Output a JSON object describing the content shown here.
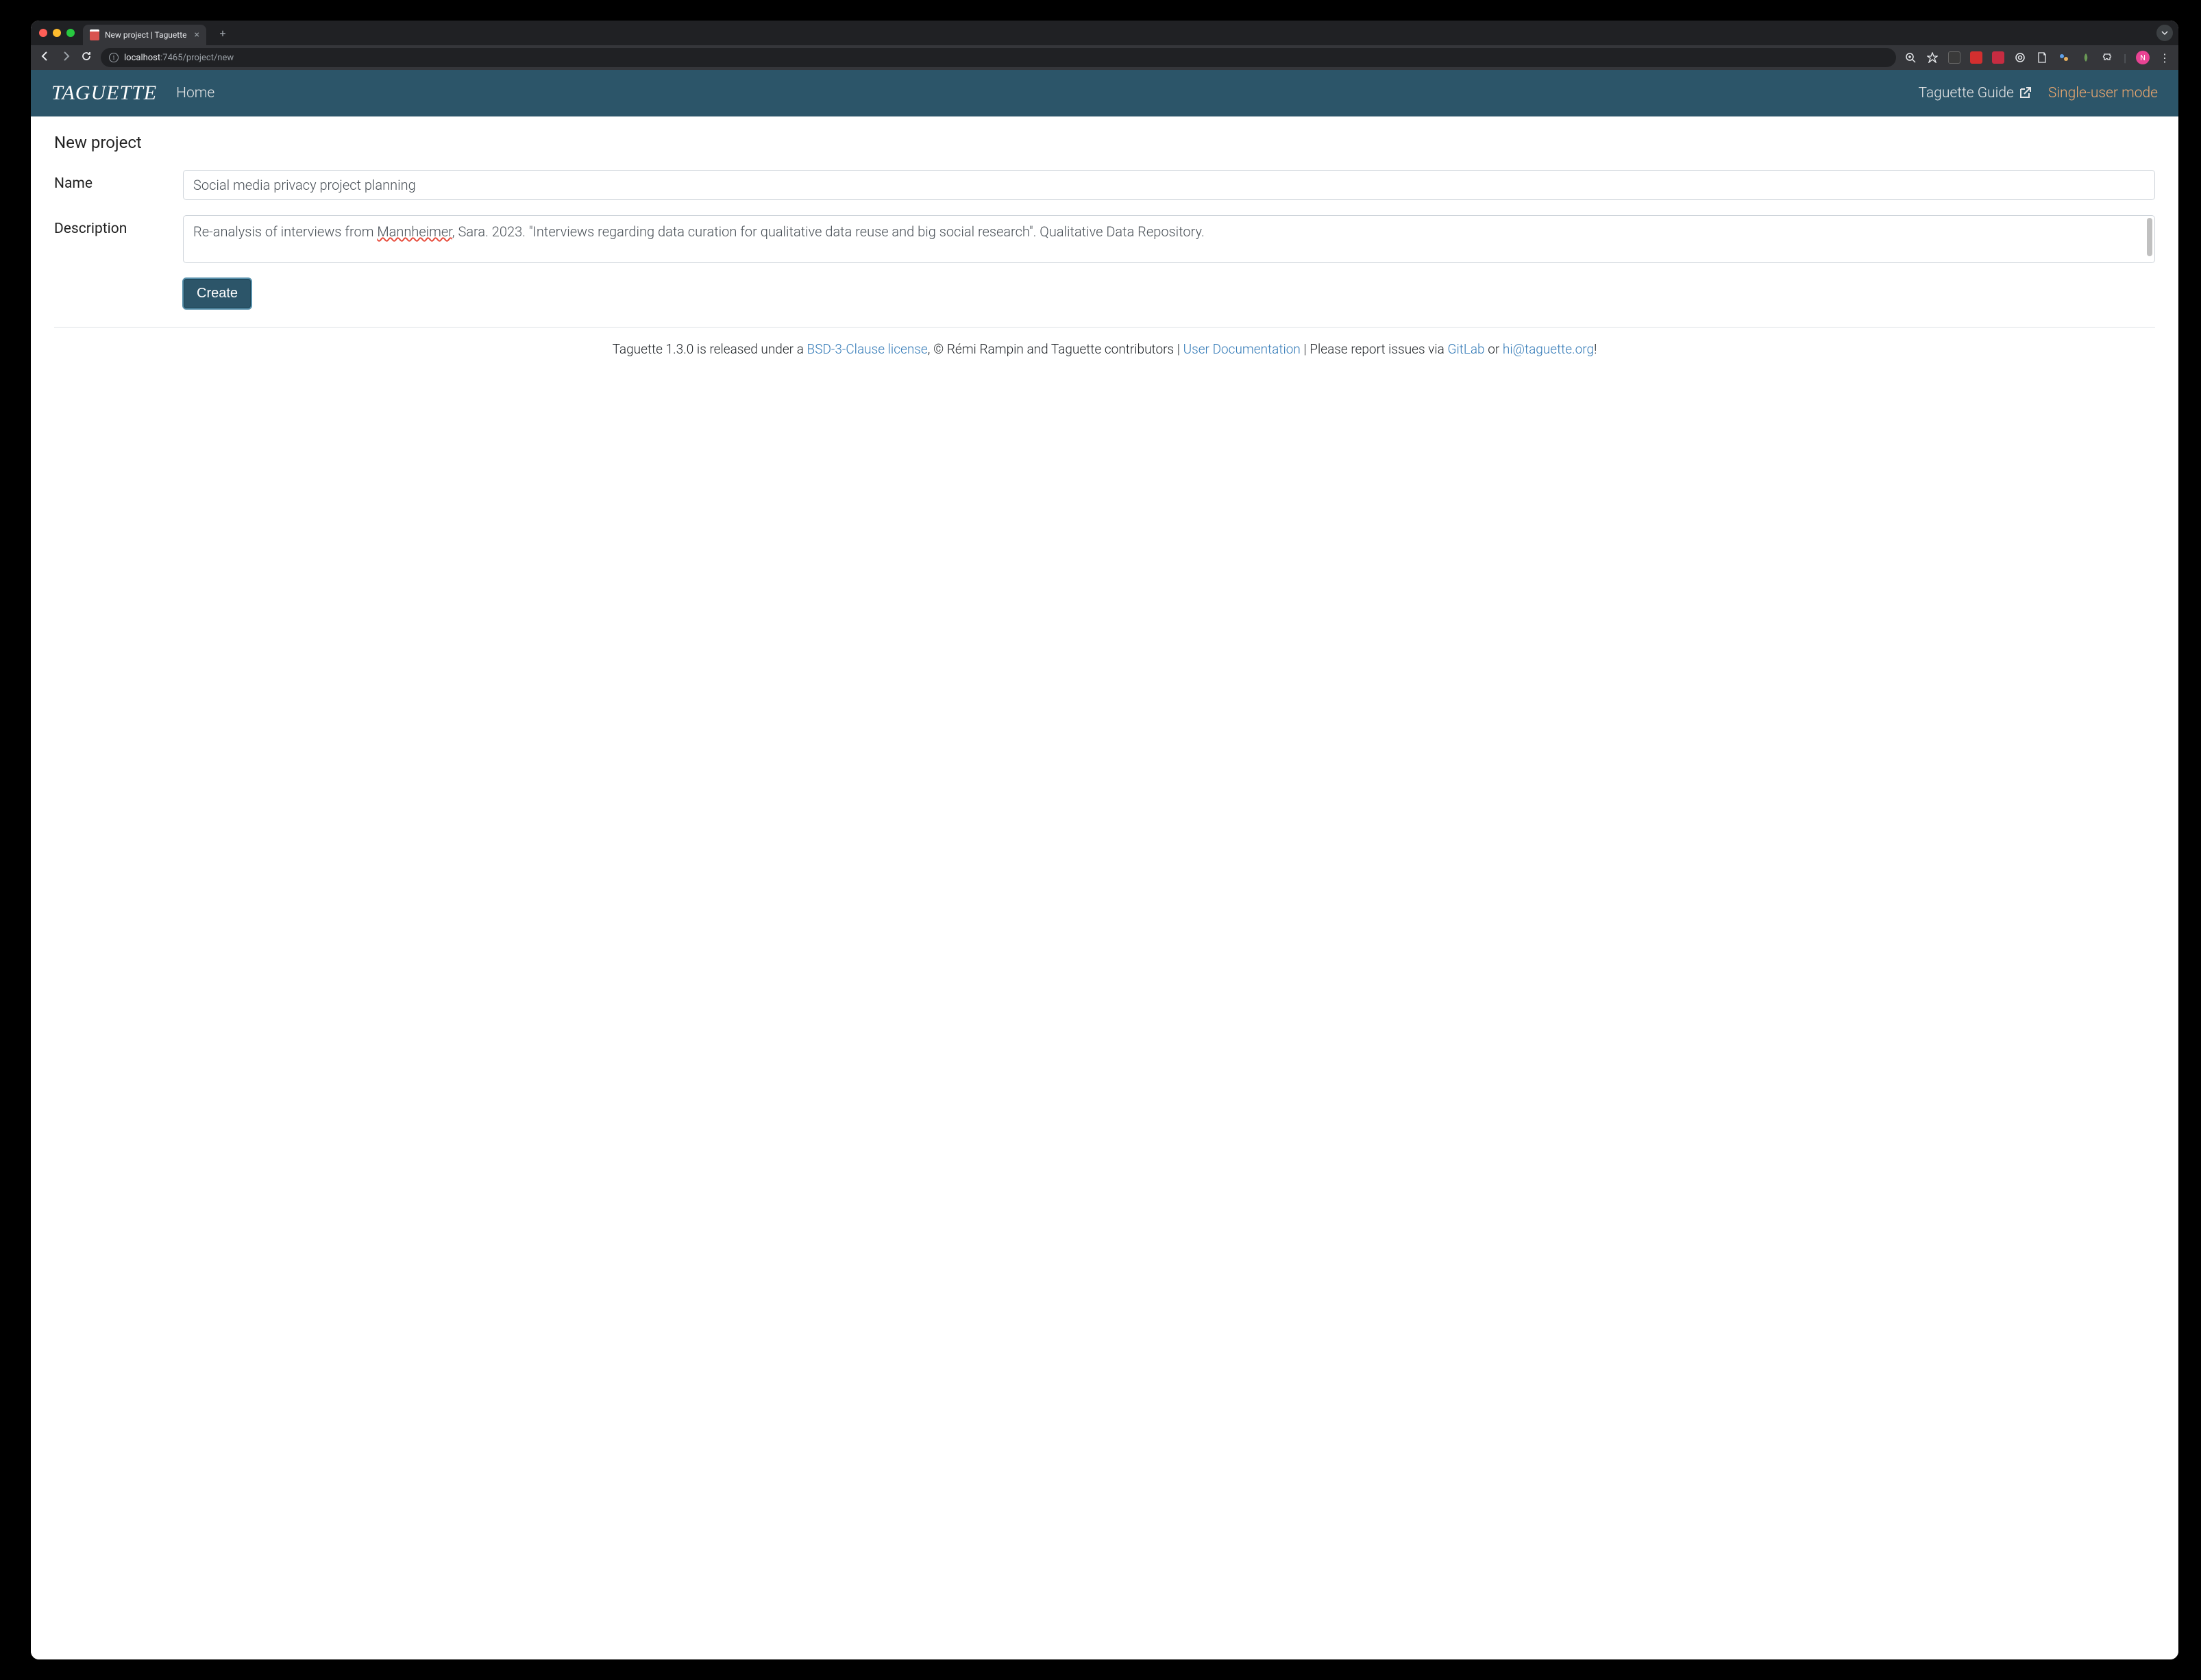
{
  "browser": {
    "tab_title": "New project | Taguette",
    "url_host": "localhost",
    "url_path": ":7465/project/new",
    "profile_initial": "N"
  },
  "header": {
    "logo": "TAGUETTE",
    "home": "Home",
    "guide": "Taguette Guide",
    "mode": "Single-user mode"
  },
  "page": {
    "title": "New project",
    "name_label": "Name",
    "name_value": "Social media privacy project planning",
    "desc_label": "Description",
    "desc_prefix": "Re-analysis of interviews from ",
    "desc_spell": "Mannheimer",
    "desc_suffix": ", Sara. 2023. \"Interviews regarding data curation for qualitative data reuse and big social research\". Qualitative Data Repository.",
    "create_btn": "Create"
  },
  "footer": {
    "t1": "Taguette 1.3.0 is released under a ",
    "link1": "BSD-3-Clause license",
    "t2": ", © Rémi Rampin and Taguette contributors | ",
    "link2": "User Documentation",
    "t3": " | Please report issues via ",
    "link3": "GitLab",
    "t4": " or ",
    "link4": "hi@taguette.org",
    "t5": "!"
  }
}
